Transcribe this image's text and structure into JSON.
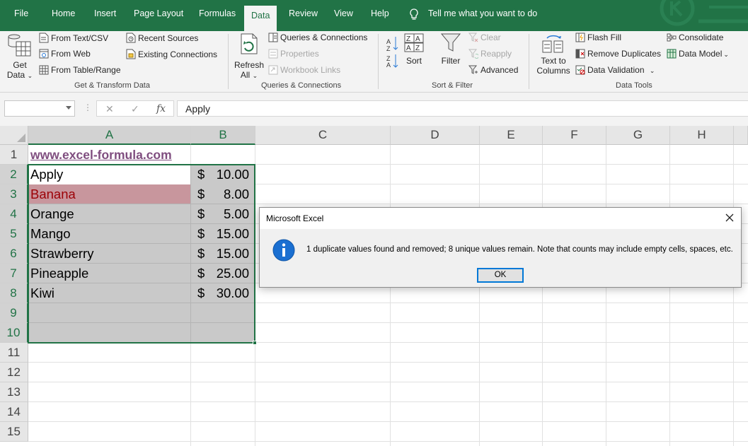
{
  "tabs": {
    "file": "File",
    "home": "Home",
    "insert": "Insert",
    "page_layout": "Page Layout",
    "formulas": "Formulas",
    "data": "Data",
    "review": "Review",
    "view": "View",
    "help": "Help",
    "tell_me": "Tell me what you want to do",
    "active": "Data"
  },
  "ribbon": {
    "get_transform": {
      "get_data_line1": "Get",
      "get_data_line2": "Data",
      "from_text_csv": "From Text/CSV",
      "from_web": "From Web",
      "from_table_range": "From Table/Range",
      "recent_sources": "Recent Sources",
      "existing_connections": "Existing Connections",
      "label": "Get & Transform Data"
    },
    "queries": {
      "refresh_line1": "Refresh",
      "refresh_line2": "All",
      "queries_connections": "Queries & Connections",
      "properties": "Properties",
      "workbook_links": "Workbook Links",
      "label": "Queries & Connections"
    },
    "sort_filter": {
      "sort": "Sort",
      "filter": "Filter",
      "clear": "Clear",
      "reapply": "Reapply",
      "advanced": "Advanced",
      "label": "Sort & Filter"
    },
    "data_tools": {
      "text_to_columns_line1": "Text to",
      "text_to_columns_line2": "Columns",
      "flash_fill": "Flash Fill",
      "remove_duplicates": "Remove Duplicates",
      "data_validation": "Data Validation",
      "consolidate": "Consolidate",
      "data_model": "Data Model",
      "label": "Data Tools"
    }
  },
  "formula_bar": {
    "name_box": "",
    "fx": "fx",
    "content": "Apply"
  },
  "sheet": {
    "columns": [
      "A",
      "B",
      "C",
      "D",
      "E",
      "F",
      "G",
      "H"
    ],
    "rows": [
      "1",
      "2",
      "3",
      "4",
      "5",
      "6",
      "7",
      "8",
      "9",
      "10",
      "11",
      "12",
      "13",
      "14",
      "15"
    ],
    "a1_link": "www.excel-formula.com",
    "currency_symbol": "$",
    "data_rows": [
      {
        "item": "Apply",
        "price": "10.00"
      },
      {
        "item": "Banana",
        "price": "8.00"
      },
      {
        "item": "Orange",
        "price": "5.00"
      },
      {
        "item": "Mango",
        "price": "15.00"
      },
      {
        "item": "Strawberry",
        "price": "15.00"
      },
      {
        "item": "Pineapple",
        "price": "25.00"
      },
      {
        "item": "Kiwi",
        "price": "30.00"
      }
    ],
    "highlight_color": "#c8969d",
    "highlight_text_color": "#9c0006",
    "selection_color": "#217346"
  },
  "dialog": {
    "title": "Microsoft Excel",
    "message": "1 duplicate values found and removed; 8 unique values remain. Note that counts may include empty cells, spaces, etc.",
    "ok": "OK",
    "icon": "info-icon"
  },
  "colors": {
    "excel_green": "#217346",
    "ribbon_bg": "#f3f3f3"
  }
}
